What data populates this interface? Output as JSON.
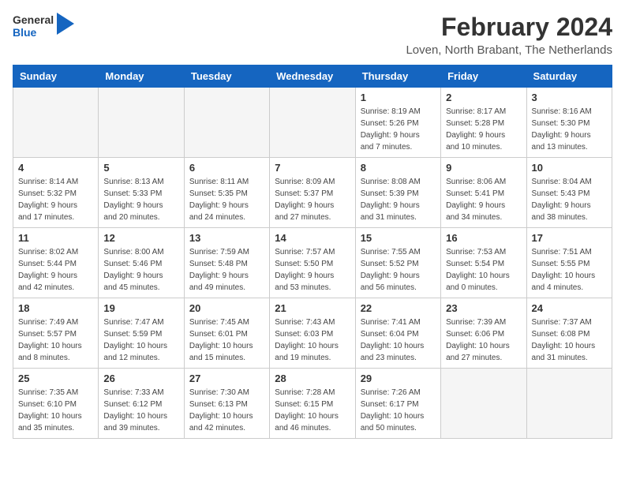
{
  "header": {
    "logo_general": "General",
    "logo_blue": "Blue",
    "title": "February 2024",
    "subtitle": "Loven, North Brabant, The Netherlands"
  },
  "days_of_week": [
    "Sunday",
    "Monday",
    "Tuesday",
    "Wednesday",
    "Thursday",
    "Friday",
    "Saturday"
  ],
  "weeks": [
    [
      {
        "day": "",
        "info": ""
      },
      {
        "day": "",
        "info": ""
      },
      {
        "day": "",
        "info": ""
      },
      {
        "day": "",
        "info": ""
      },
      {
        "day": "1",
        "info": "Sunrise: 8:19 AM\nSunset: 5:26 PM\nDaylight: 9 hours\nand 7 minutes."
      },
      {
        "day": "2",
        "info": "Sunrise: 8:17 AM\nSunset: 5:28 PM\nDaylight: 9 hours\nand 10 minutes."
      },
      {
        "day": "3",
        "info": "Sunrise: 8:16 AM\nSunset: 5:30 PM\nDaylight: 9 hours\nand 13 minutes."
      }
    ],
    [
      {
        "day": "4",
        "info": "Sunrise: 8:14 AM\nSunset: 5:32 PM\nDaylight: 9 hours\nand 17 minutes."
      },
      {
        "day": "5",
        "info": "Sunrise: 8:13 AM\nSunset: 5:33 PM\nDaylight: 9 hours\nand 20 minutes."
      },
      {
        "day": "6",
        "info": "Sunrise: 8:11 AM\nSunset: 5:35 PM\nDaylight: 9 hours\nand 24 minutes."
      },
      {
        "day": "7",
        "info": "Sunrise: 8:09 AM\nSunset: 5:37 PM\nDaylight: 9 hours\nand 27 minutes."
      },
      {
        "day": "8",
        "info": "Sunrise: 8:08 AM\nSunset: 5:39 PM\nDaylight: 9 hours\nand 31 minutes."
      },
      {
        "day": "9",
        "info": "Sunrise: 8:06 AM\nSunset: 5:41 PM\nDaylight: 9 hours\nand 34 minutes."
      },
      {
        "day": "10",
        "info": "Sunrise: 8:04 AM\nSunset: 5:43 PM\nDaylight: 9 hours\nand 38 minutes."
      }
    ],
    [
      {
        "day": "11",
        "info": "Sunrise: 8:02 AM\nSunset: 5:44 PM\nDaylight: 9 hours\nand 42 minutes."
      },
      {
        "day": "12",
        "info": "Sunrise: 8:00 AM\nSunset: 5:46 PM\nDaylight: 9 hours\nand 45 minutes."
      },
      {
        "day": "13",
        "info": "Sunrise: 7:59 AM\nSunset: 5:48 PM\nDaylight: 9 hours\nand 49 minutes."
      },
      {
        "day": "14",
        "info": "Sunrise: 7:57 AM\nSunset: 5:50 PM\nDaylight: 9 hours\nand 53 minutes."
      },
      {
        "day": "15",
        "info": "Sunrise: 7:55 AM\nSunset: 5:52 PM\nDaylight: 9 hours\nand 56 minutes."
      },
      {
        "day": "16",
        "info": "Sunrise: 7:53 AM\nSunset: 5:54 PM\nDaylight: 10 hours\nand 0 minutes."
      },
      {
        "day": "17",
        "info": "Sunrise: 7:51 AM\nSunset: 5:55 PM\nDaylight: 10 hours\nand 4 minutes."
      }
    ],
    [
      {
        "day": "18",
        "info": "Sunrise: 7:49 AM\nSunset: 5:57 PM\nDaylight: 10 hours\nand 8 minutes."
      },
      {
        "day": "19",
        "info": "Sunrise: 7:47 AM\nSunset: 5:59 PM\nDaylight: 10 hours\nand 12 minutes."
      },
      {
        "day": "20",
        "info": "Sunrise: 7:45 AM\nSunset: 6:01 PM\nDaylight: 10 hours\nand 15 minutes."
      },
      {
        "day": "21",
        "info": "Sunrise: 7:43 AM\nSunset: 6:03 PM\nDaylight: 10 hours\nand 19 minutes."
      },
      {
        "day": "22",
        "info": "Sunrise: 7:41 AM\nSunset: 6:04 PM\nDaylight: 10 hours\nand 23 minutes."
      },
      {
        "day": "23",
        "info": "Sunrise: 7:39 AM\nSunset: 6:06 PM\nDaylight: 10 hours\nand 27 minutes."
      },
      {
        "day": "24",
        "info": "Sunrise: 7:37 AM\nSunset: 6:08 PM\nDaylight: 10 hours\nand 31 minutes."
      }
    ],
    [
      {
        "day": "25",
        "info": "Sunrise: 7:35 AM\nSunset: 6:10 PM\nDaylight: 10 hours\nand 35 minutes."
      },
      {
        "day": "26",
        "info": "Sunrise: 7:33 AM\nSunset: 6:12 PM\nDaylight: 10 hours\nand 39 minutes."
      },
      {
        "day": "27",
        "info": "Sunrise: 7:30 AM\nSunset: 6:13 PM\nDaylight: 10 hours\nand 42 minutes."
      },
      {
        "day": "28",
        "info": "Sunrise: 7:28 AM\nSunset: 6:15 PM\nDaylight: 10 hours\nand 46 minutes."
      },
      {
        "day": "29",
        "info": "Sunrise: 7:26 AM\nSunset: 6:17 PM\nDaylight: 10 hours\nand 50 minutes."
      },
      {
        "day": "",
        "info": ""
      },
      {
        "day": "",
        "info": ""
      }
    ]
  ]
}
